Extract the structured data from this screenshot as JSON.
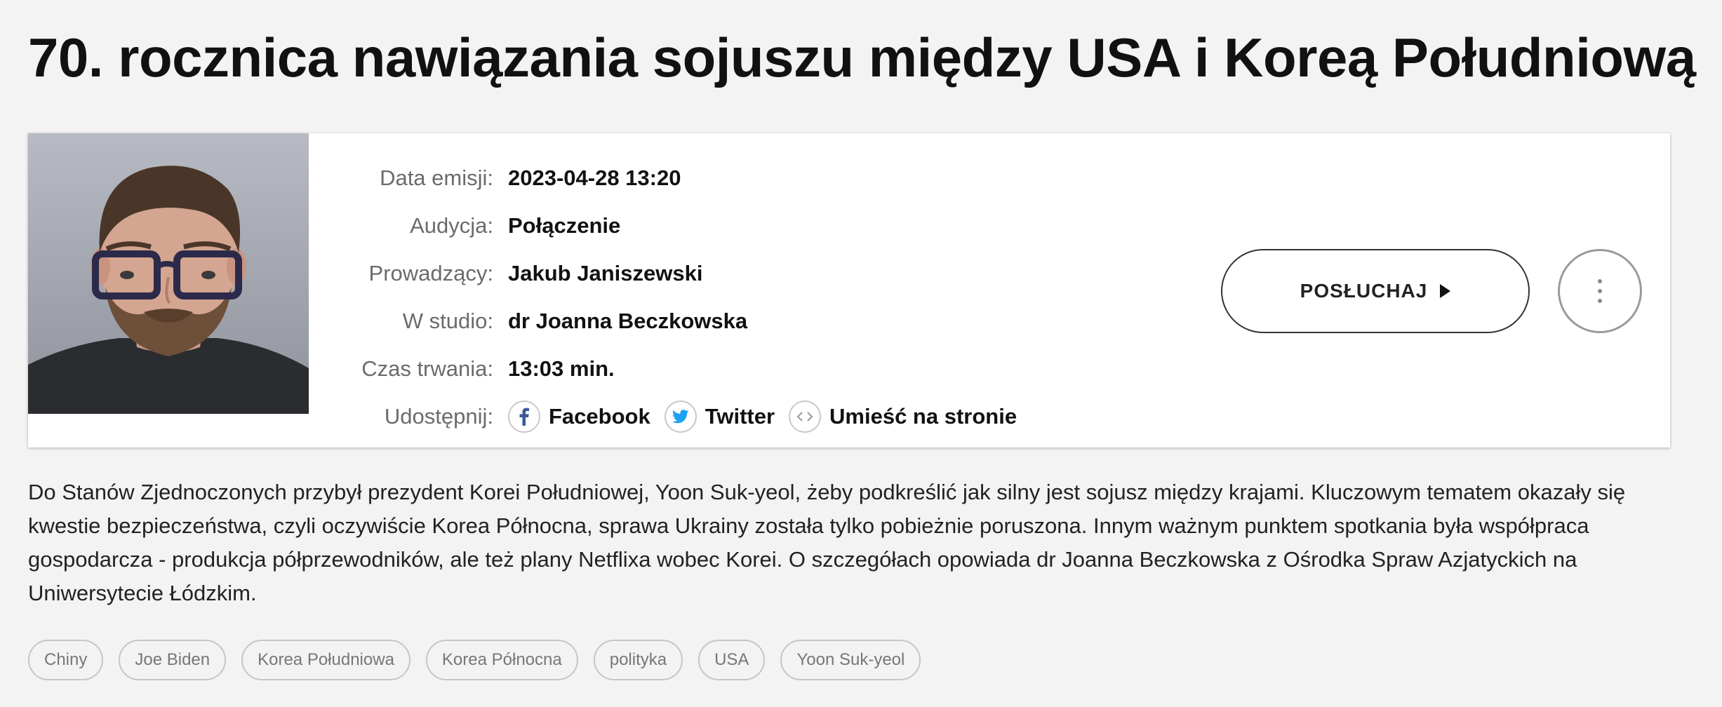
{
  "page": {
    "title": "70. rocznica nawiązania sojuszu między USA i Koreą Południową"
  },
  "episode": {
    "photo_alt": "Jakub Janiszewski",
    "fields": [
      {
        "label": "Data emisji:",
        "value": "2023-04-28 13:20"
      },
      {
        "label": "Audycja:",
        "value": "Połączenie"
      },
      {
        "label": "Prowadzący:",
        "value": "Jakub Janiszewski"
      },
      {
        "label": "W studio:",
        "value": "dr Joanna Beczkowska"
      },
      {
        "label": "Czas trwania:",
        "value": "13:03 min."
      }
    ],
    "share": {
      "label": "Udostępnij:",
      "facebook": "Facebook",
      "twitter": "Twitter",
      "embed": "Umieść na stronie"
    },
    "listen_label": "POSŁUCHAJ"
  },
  "description": "Do Stanów Zjednoczonych przybył prezydent Korei Południowej, Yoon Suk-yeol, żeby podkreślić jak silny jest sojusz między krajami. Kluczowym tematem okazały się kwestie bezpieczeństwa, czyli oczywiście Korea Północna, sprawa Ukrainy została tylko pobieżnie poruszona. Innym ważnym punktem spotkania była współpraca gospodarcza - produkcja półprzewodników, ale też plany Netflixa wobec Korei. O szczegółach opowiada dr Joanna Beczkowska z Ośrodka Spraw Azjatyckich na Uniwersytecie Łódzkim.",
  "tags": [
    "Chiny",
    "Joe Biden",
    "Korea Południowa",
    "Korea Północna",
    "polityka",
    "USA",
    "Yoon Suk-yeol"
  ],
  "colors": {
    "background": "#f3f3f3",
    "card": "#ffffff",
    "facebook": "#3b5998",
    "twitter": "#1da1f2",
    "text": "#111111",
    "muted": "#6b6b6b"
  },
  "icons": [
    "facebook-icon",
    "twitter-icon",
    "embed-code-icon",
    "play-icon",
    "more-vertical-icon"
  ]
}
